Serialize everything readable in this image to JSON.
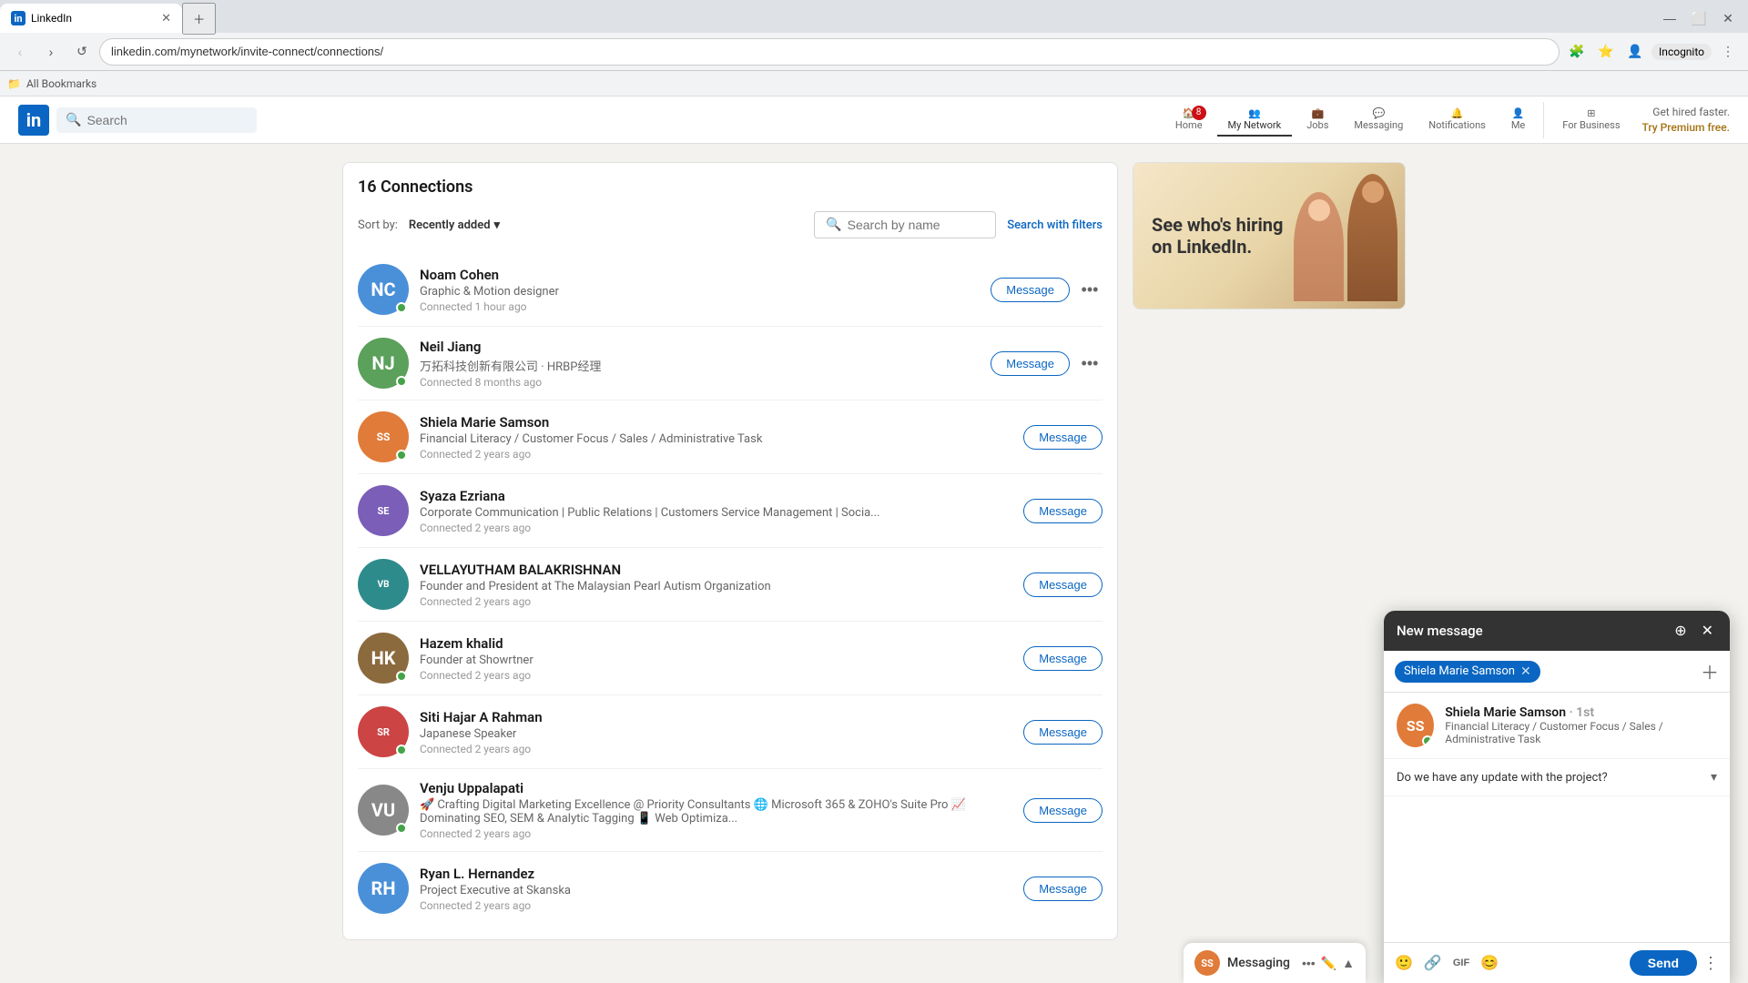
{
  "browser": {
    "tab_title": "LinkedIn",
    "tab_favicon": "in",
    "address": "linkedin.com/mynetwork/invite-connect/connections/",
    "bookmarks_label": "All Bookmarks"
  },
  "header": {
    "logo": "in",
    "search_placeholder": "Search",
    "nav": {
      "home_label": "Home",
      "home_badge": "8",
      "network_label": "My Network",
      "jobs_label": "Jobs",
      "messaging_label": "Messaging",
      "notifications_label": "Notifications",
      "me_label": "Me",
      "for_business_label": "For Business",
      "premium_line1": "Get hired faster.",
      "premium_line2": "Try Premium free."
    }
  },
  "connections": {
    "title": "16 Connections",
    "sort_label": "Sort by:",
    "sort_value": "Recently added",
    "search_placeholder": "Search by name",
    "search_filters_label": "Search with filters",
    "items": [
      {
        "name": "Noam Cohen",
        "title": "Graphic & Motion designer",
        "connected": "Connected 1 hour ago",
        "online": true,
        "avatar_color": "av-blue",
        "avatar_initials": "NC"
      },
      {
        "name": "Neil Jiang",
        "title": "万拓科技创新有限公司 · HRBP经理",
        "connected": "Connected 8 months ago",
        "online": true,
        "avatar_color": "av-green",
        "avatar_initials": "NJ"
      },
      {
        "name": "Shiela Marie Samson",
        "title": "Financial Literacy / Customer Focus / Sales / Administrative Task",
        "connected": "Connected 2 years ago",
        "online": true,
        "avatar_color": "av-orange",
        "avatar_initials": "SS"
      },
      {
        "name": "Syaza Ezriana",
        "title": "Corporate Communication | Public Relations | Customers Service Management | Socia...",
        "connected": "Connected 2 years ago",
        "online": false,
        "avatar_color": "av-purple",
        "avatar_initials": "SE"
      },
      {
        "name": "VELLAYUTHAM BALAKRISHNAN",
        "title": "Founder and President at The Malaysian Pearl Autism Organization",
        "connected": "Connected 2 years ago",
        "online": false,
        "avatar_color": "av-teal",
        "avatar_initials": "VB"
      },
      {
        "name": "Hazem khalid",
        "title": "Founder at Showrtner",
        "connected": "Connected 2 years ago",
        "online": true,
        "avatar_color": "av-brown",
        "avatar_initials": "HK"
      },
      {
        "name": "Siti Hajar A Rahman",
        "title": "Japanese Speaker",
        "connected": "Connected 2 years ago",
        "online": true,
        "avatar_color": "av-red",
        "avatar_initials": "SR"
      },
      {
        "name": "Venju Uppalapati",
        "title": "🚀 Crafting Digital Marketing Excellence @ Priority Consultants 🌐 Microsoft 365 & ZOHO's Suite Pro 📈 Dominating SEO, SEM & Analytic Tagging 📱 Web Optimiza...",
        "connected": "Connected 2 years ago",
        "online": true,
        "avatar_color": "av-gray",
        "avatar_initials": "VU"
      },
      {
        "name": "Ryan L. Hernandez",
        "title": "Project Executive at Skanska",
        "connected": "Connected 2 years ago",
        "online": false,
        "avatar_color": "av-blue",
        "avatar_initials": "RH"
      }
    ],
    "message_btn": "Message"
  },
  "ad": {
    "line1": "See who's hiring",
    "line2": "on LinkedIn."
  },
  "new_message_modal": {
    "title": "New message",
    "recipient_name": "Shiela Marie\nSamson",
    "recipient_chip": "Shiela Marie Samson",
    "search_placeholder": "",
    "suggested_name": "Shiela Marie Samson",
    "suggested_degree": "· 1st",
    "suggested_headline": "Financial Literacy / Customer Focus / Sales / Administrative Task",
    "preview_text": "Do we have any update with the project?",
    "send_label": "Send"
  },
  "messaging_bar": {
    "label": "Messaging"
  }
}
